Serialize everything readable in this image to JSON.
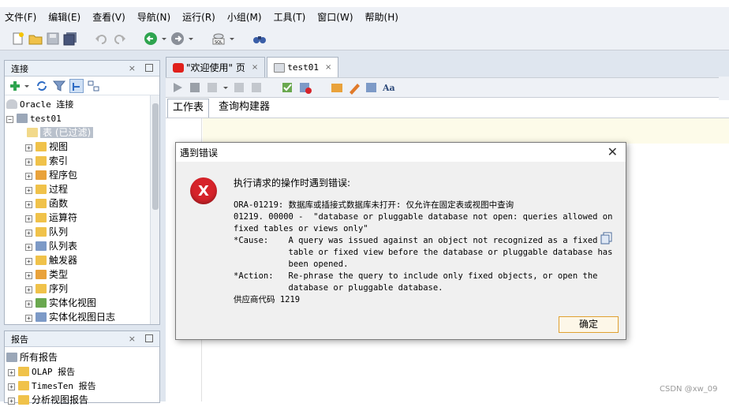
{
  "menu": [
    "文件(F)",
    "编辑(E)",
    "查看(V)",
    "导航(N)",
    "运行(R)",
    "小组(M)",
    "工具(T)",
    "窗口(W)",
    "帮助(H)"
  ],
  "connections_panel": {
    "title": "连接",
    "root": "Oracle 连接",
    "connection": "test01",
    "items": [
      "表 (已过滤)",
      "视图",
      "索引",
      "程序包",
      "过程",
      "函数",
      "运算符",
      "队列",
      "队列表",
      "触发器",
      "类型",
      "序列",
      "实体化视图",
      "实体化视图日志"
    ]
  },
  "reports_panel": {
    "title": "报告",
    "root": "所有报告",
    "items": [
      "OLAP 报告",
      "TimesTen 报告",
      "分析视图报告"
    ]
  },
  "tabs": [
    {
      "label": "\"欢迎使用\" 页",
      "active": false
    },
    {
      "label": "test01",
      "active": true
    }
  ],
  "subtabs": [
    "工作表",
    "查询构建器"
  ],
  "dialog": {
    "title": "遇到错误",
    "heading": "执行请求的操作时遇到错误:",
    "lines": [
      "ORA-01219: 数据库或插接式数据库未打开: 仅允许在固定表或视图中查询",
      "01219. 00000 -  \"database or pluggable database not open: queries allowed on",
      "fixed tables or views only\"",
      "*Cause:    A query was issued against an object not recognized as a fixed",
      "           table or fixed view before the database or pluggable database has",
      "           been opened.",
      "*Action:   Re-phrase the query to include only fixed objects, or open the",
      "           database or pluggable database.",
      "供应商代码 1219"
    ],
    "ok_label": "确定"
  },
  "watermark": "CSDN @xw_09"
}
